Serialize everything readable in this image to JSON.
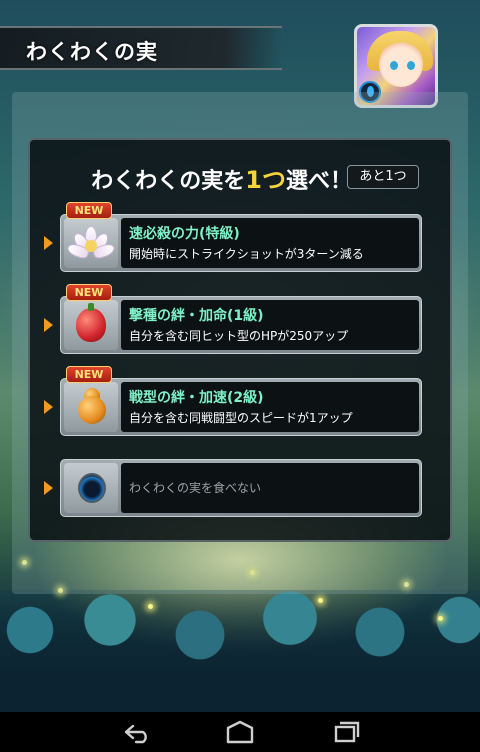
{
  "header": {
    "title": "わくわくの実"
  },
  "dialog": {
    "heading_prefix": "わくわくの実を",
    "heading_count": "1つ",
    "heading_suffix": "選べ！",
    "remaining": "あと1つ"
  },
  "options": [
    {
      "badge": "NEW",
      "title": "速必殺の力(特級)",
      "description": "開始時にストライクショットが3ターン減る",
      "icon": "lotus-fruit-icon"
    },
    {
      "badge": "NEW",
      "title": "撃種の絆・加命(1級)",
      "description": "自分を含む同ヒット型のHPが250アップ",
      "icon": "red-fruit-icon"
    },
    {
      "badge": "NEW",
      "title": "戦型の絆・加速(2級)",
      "description": "自分を含む同戦闘型のスピードが1アップ",
      "icon": "gourd-fruit-icon"
    }
  ],
  "skip_option": {
    "label": "わくわくの実を食べない",
    "icon": "empty-orb-icon"
  },
  "colors": {
    "title_accent": "#7ef0c6",
    "count_highlight": "#f5d43a",
    "arrow": "#f39a1e",
    "new_badge": "#c83220"
  },
  "navbar": {
    "back": "back-icon",
    "home": "home-icon",
    "recents": "recents-icon"
  }
}
